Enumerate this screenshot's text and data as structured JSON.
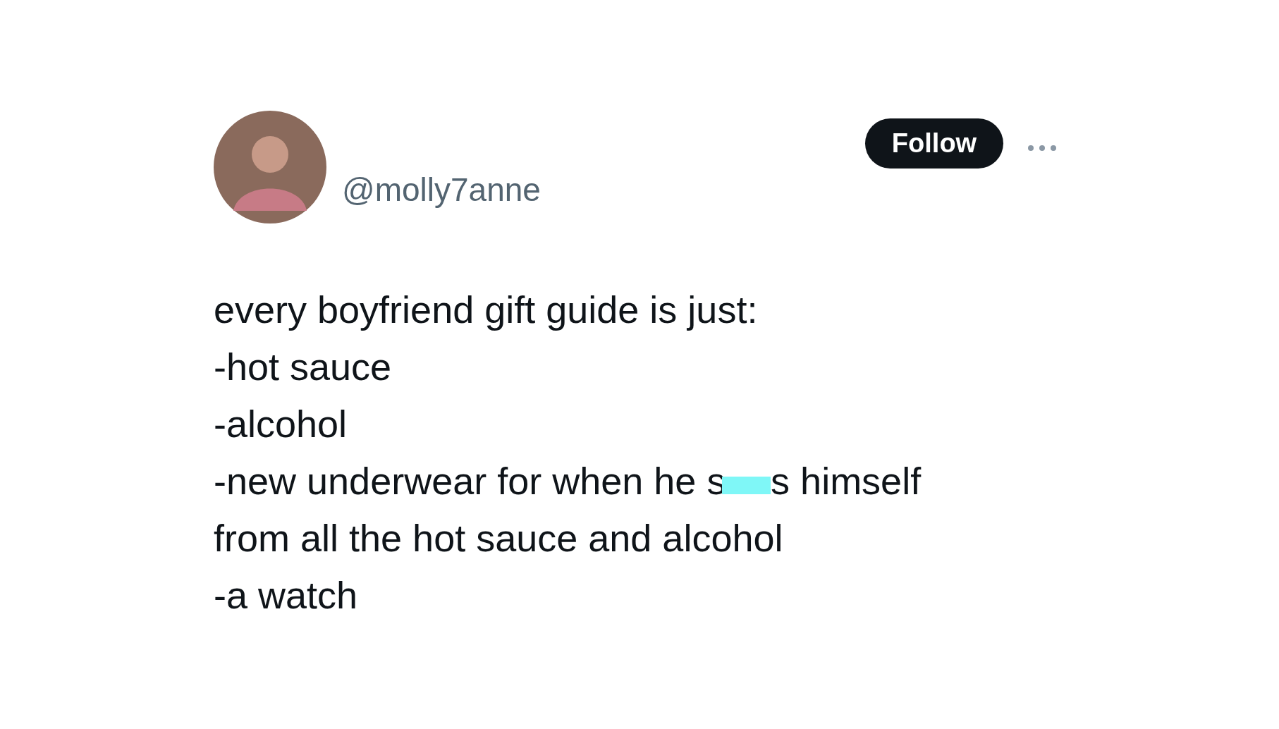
{
  "user": {
    "handle": "@molly7anne"
  },
  "follow_button": {
    "label": "Follow"
  },
  "tweet": {
    "lines": [
      {
        "text": "every boyfriend gift guide is just:"
      },
      {
        "text": "-hot sauce"
      },
      {
        "text": "-alcohol"
      },
      {
        "text": "-new underwear for when he s",
        "censored": true,
        "after": "s himself"
      },
      {
        "text": "from all the hot sauce and alcohol"
      },
      {
        "text": "-a watch"
      }
    ]
  }
}
